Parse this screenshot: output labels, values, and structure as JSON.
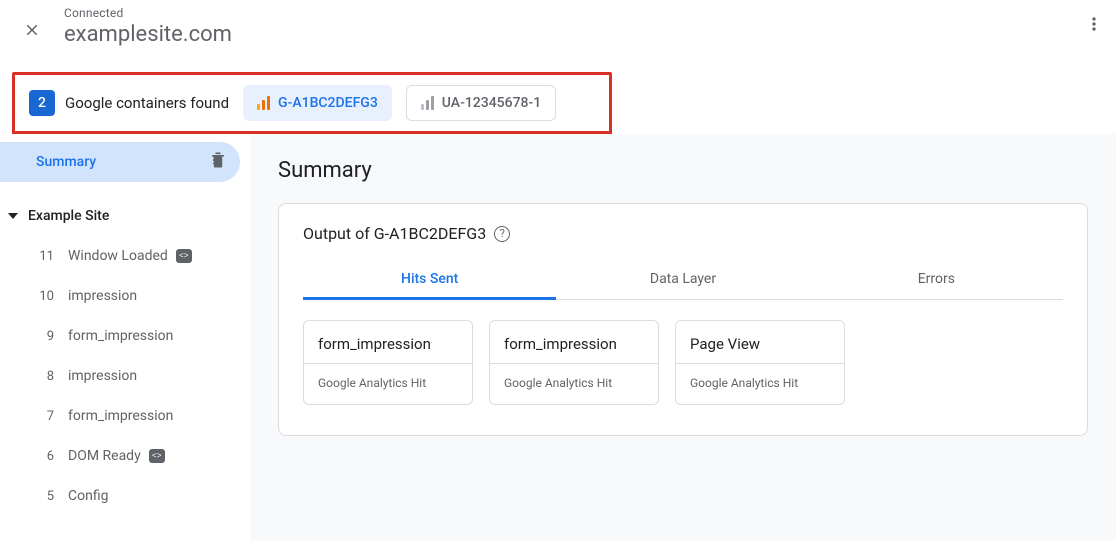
{
  "header": {
    "status": "Connected",
    "site": "examplesite.com"
  },
  "containers": {
    "count": "2",
    "label": "Google containers found",
    "items": [
      {
        "id": "G-A1BC2DEFG3",
        "active": true
      },
      {
        "id": "UA-12345678-1",
        "active": false
      }
    ]
  },
  "sidebar": {
    "summary": "Summary",
    "group": "Example Site",
    "items": [
      {
        "n": "11",
        "label": "Window Loaded",
        "badge": true
      },
      {
        "n": "10",
        "label": "impression",
        "badge": false
      },
      {
        "n": "9",
        "label": "form_impression",
        "badge": false
      },
      {
        "n": "8",
        "label": "impression",
        "badge": false
      },
      {
        "n": "7",
        "label": "form_impression",
        "badge": false
      },
      {
        "n": "6",
        "label": "DOM Ready",
        "badge": true
      },
      {
        "n": "5",
        "label": "Config",
        "badge": false
      }
    ]
  },
  "content": {
    "heading": "Summary",
    "output_prefix": "Output of ",
    "output_id": "G-A1BC2DEFG3",
    "tabs": [
      "Hits Sent",
      "Data Layer",
      "Errors"
    ],
    "hits": [
      {
        "title": "form_impression",
        "sub": "Google Analytics Hit"
      },
      {
        "title": "form_impression",
        "sub": "Google Analytics Hit"
      },
      {
        "title": "Page View",
        "sub": "Google Analytics Hit"
      }
    ]
  }
}
